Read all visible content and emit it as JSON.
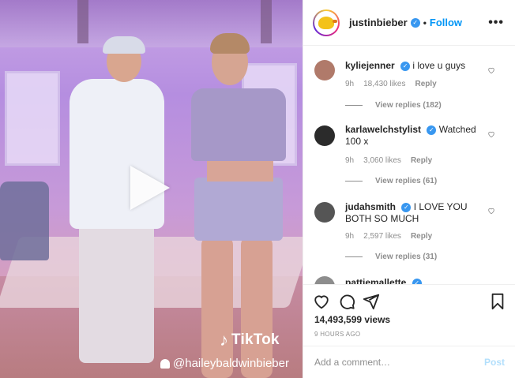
{
  "media": {
    "tiktok_icon": "tiktok-note-icon",
    "tiktok_label": "TikTok",
    "handle": "@haileybaldwinbieber"
  },
  "header": {
    "username": "justinbieber",
    "separator": "•",
    "follow_label": "Follow",
    "more_label": "•••"
  },
  "comments": [
    {
      "username": "kyliejenner",
      "verified": true,
      "text": "i love u guys",
      "time": "9h",
      "likes": "18,430 likes",
      "reply_label": "Reply",
      "view_replies": "View replies (182)",
      "avatar_color": "#b07a6a"
    },
    {
      "username": "karlawelchstylist",
      "verified": true,
      "text": "Watched 100 x",
      "time": "9h",
      "likes": "3,060 likes",
      "reply_label": "Reply",
      "view_replies": "View replies (61)",
      "avatar_color": "#2b2b2b"
    },
    {
      "username": "judahsmith",
      "verified": true,
      "text": "I LOVE YOU BOTH SO MUCH",
      "time": "9h",
      "likes": "2,597 likes",
      "reply_label": "Reply",
      "view_replies": "View replies (31)",
      "avatar_color": "#555555"
    },
    {
      "username": "pattiemallette",
      "verified": true,
      "avatar_color": "#8d8d8d"
    }
  ],
  "post": {
    "views": "14,493,599 views",
    "timestamp": "9 HOURS AGO"
  },
  "add_comment": {
    "placeholder": "Add a comment…",
    "post_label": "Post"
  },
  "colors": {
    "accent": "#0095f6",
    "verified": "#3897f0",
    "muted": "#8e8e8e"
  }
}
